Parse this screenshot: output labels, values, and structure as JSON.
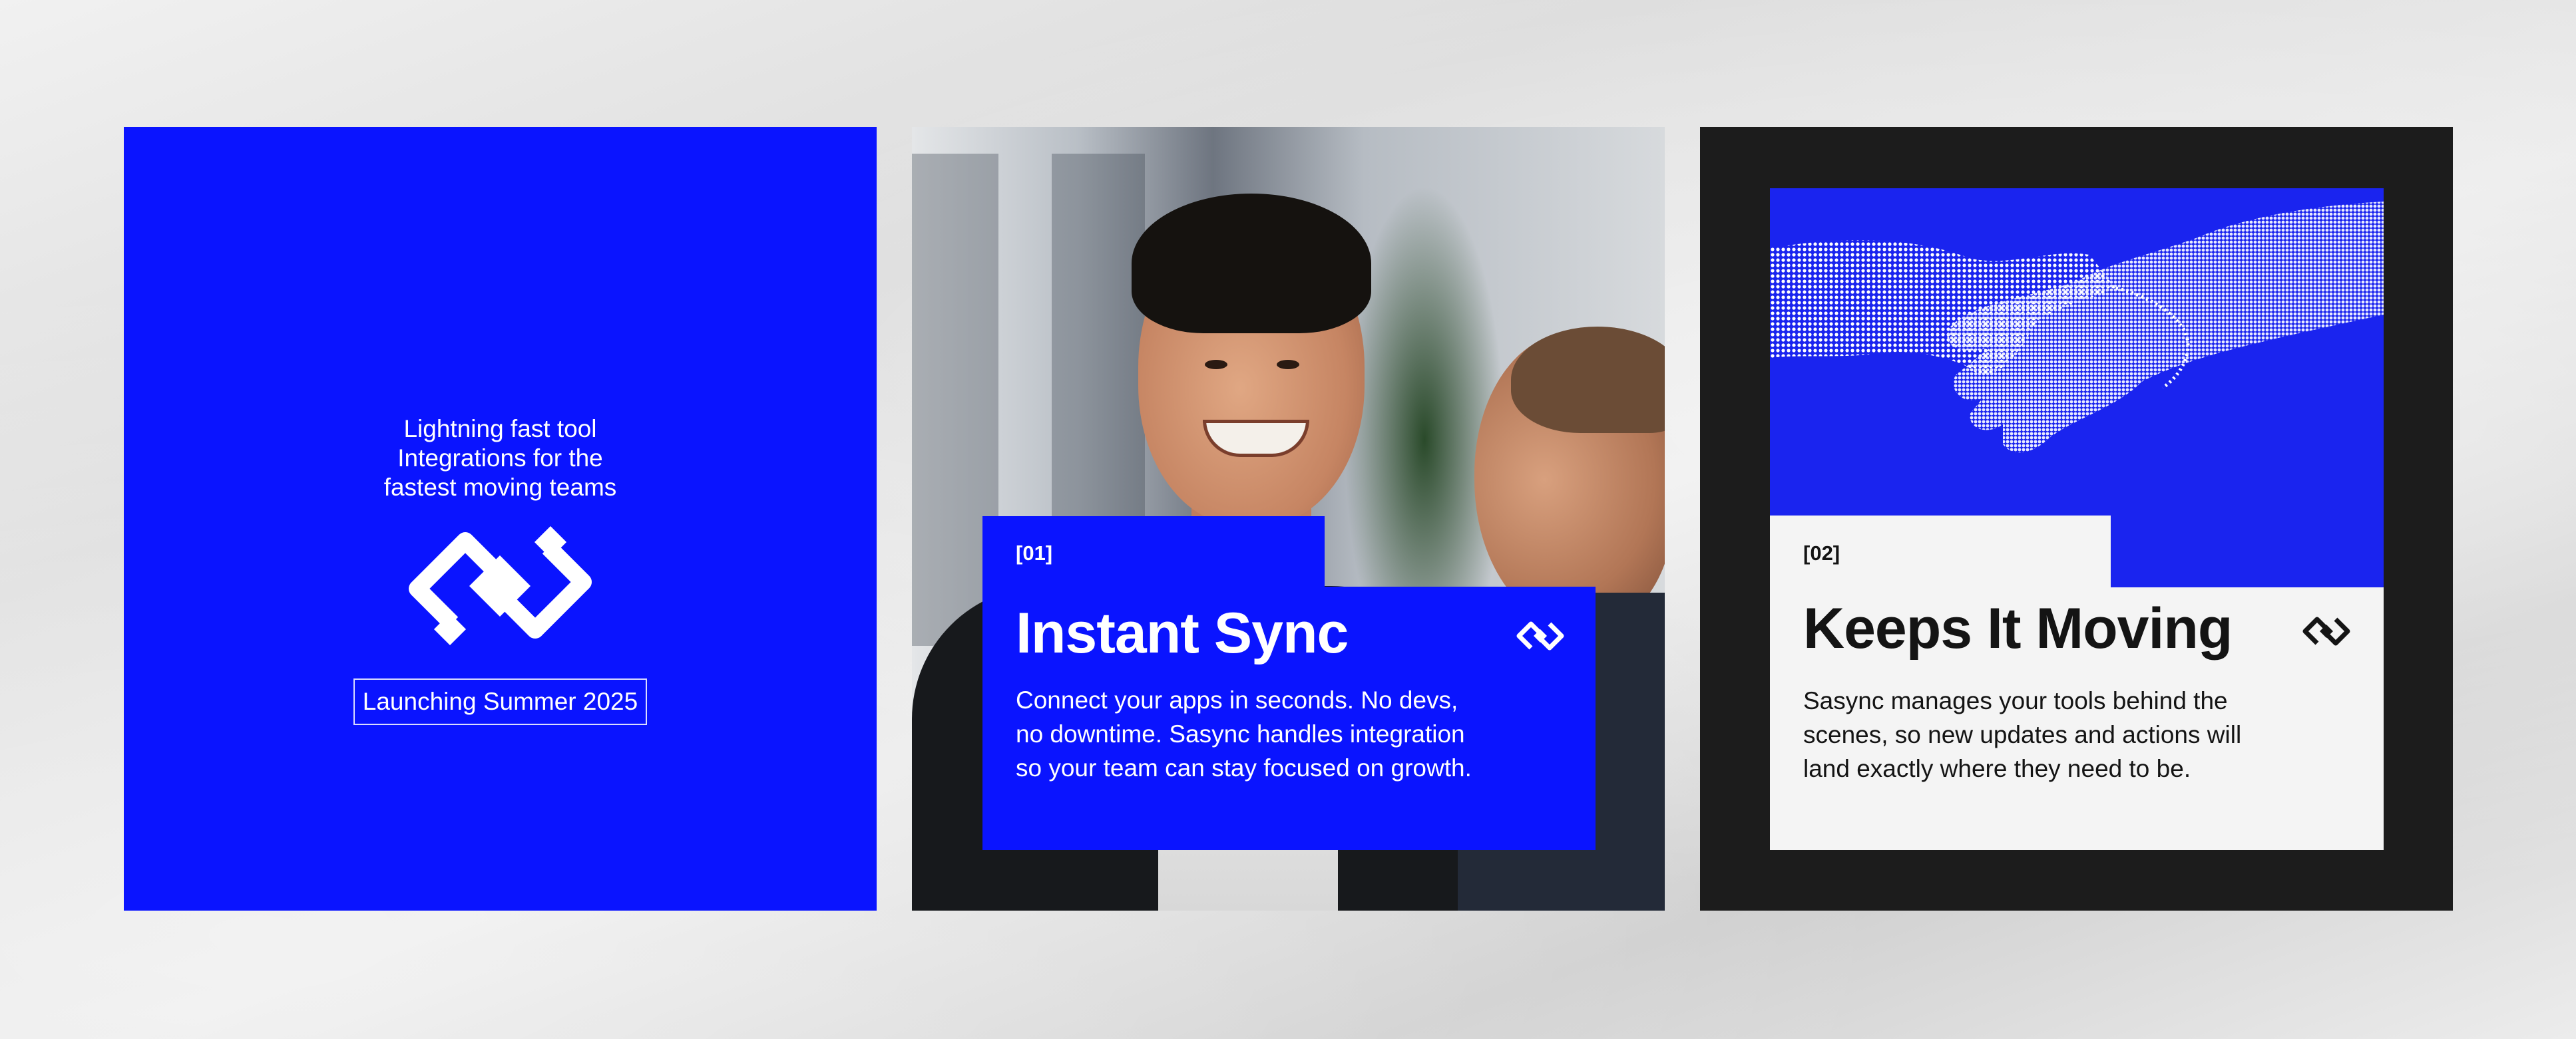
{
  "brand": {
    "accent_color": "#0a14ff",
    "dark_color": "#1c1c1c",
    "light_color": "#f4f4f4",
    "logo_icon": "linked-diamonds-icon"
  },
  "card1": {
    "tagline_line1": "Lightning fast tool",
    "tagline_line2": "Integrations for the",
    "tagline_line3": "fastest moving teams",
    "launch_label": "Launching Summer 2025"
  },
  "card2": {
    "index_label": "[01]",
    "title": "Instant Sync",
    "body_line1": "Connect your apps in seconds. No devs,",
    "body_line2": "no downtime. Sasync handles integration",
    "body_line3": "so your team can stay focused on growth."
  },
  "card3": {
    "index_label": "[02]",
    "title": "Keeps It Moving",
    "body_line1": "Sasync manages your tools behind the",
    "body_line2": "scenes, so new updates and actions will",
    "body_line3": "land exactly where they need to be."
  }
}
